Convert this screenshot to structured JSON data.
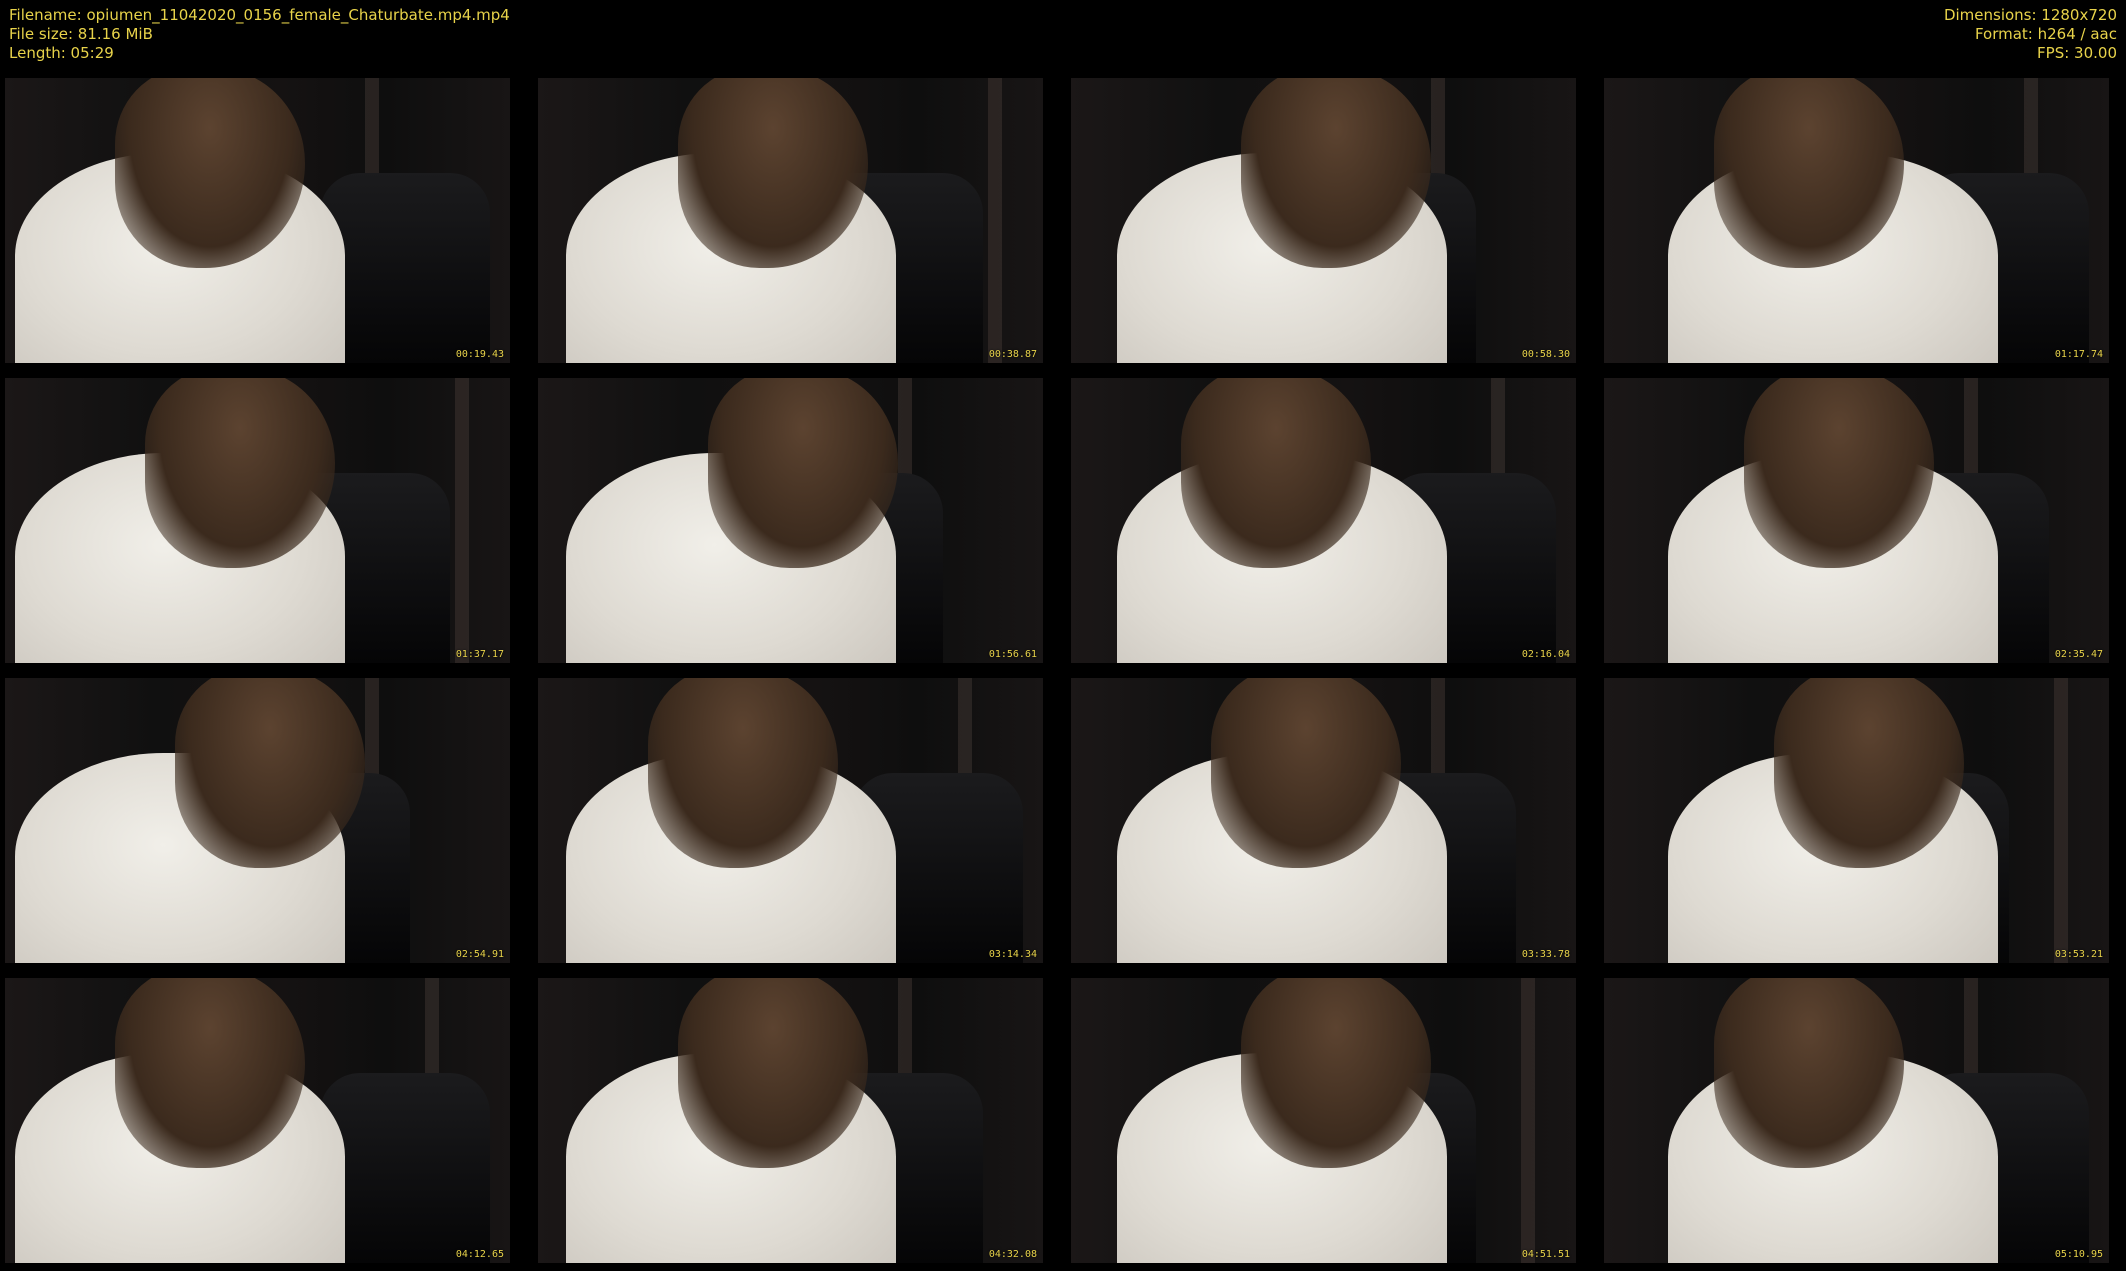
{
  "header": {
    "filename": "Filename: opiumen_11042020_0156_female_Chaturbate.mp4.mp4",
    "filesize": "File size: 81.16 MiB",
    "length": "Length: 05:29",
    "dimensions": "Dimensions: 1280x720",
    "format": "Format: h264 / aac",
    "fps": "FPS: 30.00"
  },
  "thumbs": [
    {
      "ts": "00:19.43"
    },
    {
      "ts": "00:38.87"
    },
    {
      "ts": "00:58.30"
    },
    {
      "ts": "01:17.74"
    },
    {
      "ts": "01:37.17"
    },
    {
      "ts": "01:56.61"
    },
    {
      "ts": "02:16.04"
    },
    {
      "ts": "02:35.47"
    },
    {
      "ts": "02:54.91"
    },
    {
      "ts": "03:14.34"
    },
    {
      "ts": "03:33.78"
    },
    {
      "ts": "03:53.21"
    },
    {
      "ts": "04:12.65"
    },
    {
      "ts": "04:32.08"
    },
    {
      "ts": "04:51.51"
    },
    {
      "ts": "05:10.95"
    }
  ],
  "colors": {
    "text": "#e8d34a",
    "background": "#000000"
  }
}
